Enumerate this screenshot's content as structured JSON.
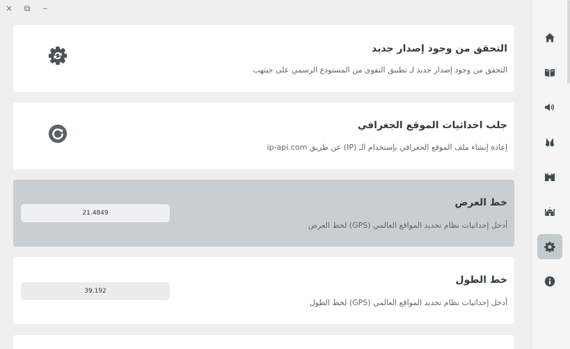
{
  "window_controls": {
    "close": "×",
    "restore": "⧉",
    "minimize": "–"
  },
  "sidebar": {
    "items": [
      {
        "icon": "home-icon",
        "active": false
      },
      {
        "icon": "quran-book-icon",
        "active": false
      },
      {
        "icon": "speaker-icon",
        "active": false
      },
      {
        "icon": "prayer-hands-icon",
        "active": false
      },
      {
        "icon": "castle-icon",
        "active": false
      },
      {
        "icon": "mosque-icon",
        "active": false
      },
      {
        "icon": "gear-icon",
        "active": true
      },
      {
        "icon": "info-icon",
        "active": false
      }
    ]
  },
  "cards": {
    "update": {
      "title": "التحقق من وجود إصدار جديد",
      "description": "التحقق من وجود إصدار جديد لـ تطبيق التقوى من المستودع الرسمي على جيتهب",
      "icon": "update-gear-icon"
    },
    "geo": {
      "title": "جلب احداثيات الموقع الجغرافي",
      "description": "إعادة إنشاء ملف الموقع الجغرافي بإستخدام الـ (IP) عن طريق ip-api.com",
      "icon": "refresh-icon"
    },
    "latitude": {
      "title": "خط العرض",
      "description": "أدخل إحداثيات نظام تحديد المواقع العالمي (GPS) لخط العرض",
      "value": "21.4849"
    },
    "longitude": {
      "title": "خط الطول",
      "description": "أدخل إحداثيات نظام تحديد المواقع العالمي (GPS) لخط الطول",
      "value": "39.192"
    }
  },
  "colors": {
    "accent_icon": "#3f4b52",
    "highlight_card": "#c8ced1",
    "active_sidebar": "#c3c9cc"
  }
}
